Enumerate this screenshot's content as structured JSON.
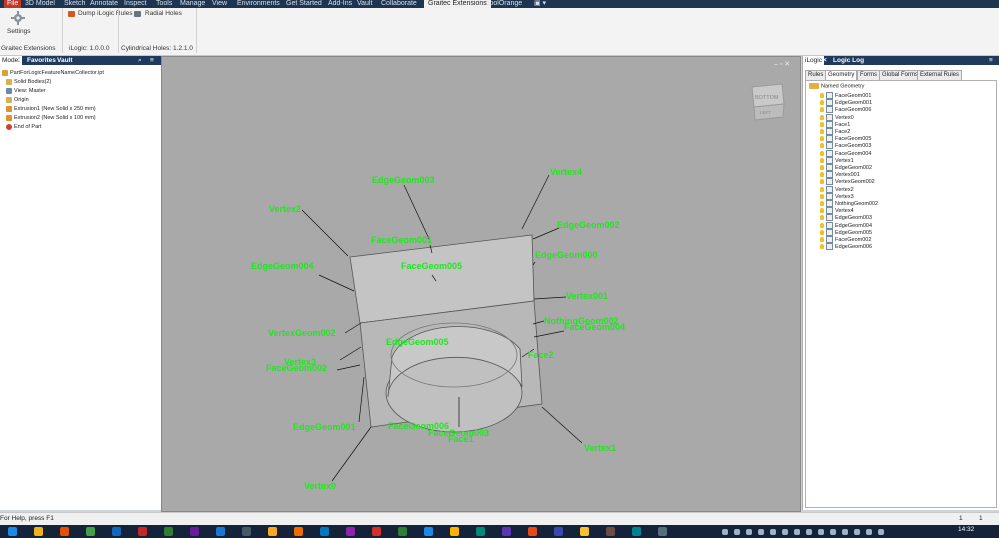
{
  "menubar": {
    "items": [
      "File",
      "3D Model",
      "Sketch",
      "Annotate",
      "Inspect",
      "Tools",
      "Manage",
      "View",
      "Environments",
      "Get Started",
      "Add-Ins",
      "Vault",
      "Collaborate",
      "Graitec Extensions",
      "coolOrange"
    ],
    "active_index": 13
  },
  "ribbon": {
    "settings_label": "Settings",
    "dump_label": "Dump iLogic Rules",
    "radial_label": "Radial Holes",
    "panel_graitec": "Graitec Extensions",
    "panel_ilogic": "iLogic: 1.0.0.0",
    "panel_holes": "Cylindrical Holes: 1.2.1.0"
  },
  "left_panel": {
    "tabs": [
      "Model",
      "Favorites",
      "Vault"
    ],
    "tree": [
      {
        "label": "PartForLogicFeatureNameCollector.ipt",
        "icon": "part-icon"
      },
      {
        "label": "Solid Bodies(2)",
        "icon": "folder-icon"
      },
      {
        "label": "View: Master",
        "icon": "view-icon"
      },
      {
        "label": "Origin",
        "icon": "folder-icon"
      },
      {
        "label": "Extrusion1 (New Solid x 250 mm)",
        "icon": "extrude-icon"
      },
      {
        "label": "Extrusion2 (New Solid x 100 mm)",
        "icon": "extrude-icon"
      },
      {
        "label": "End of Part",
        "icon": "end-icon"
      }
    ]
  },
  "viewport": {
    "viewcube_face": "BOTTOM",
    "viewcube_side": "LEFT",
    "labels": [
      {
        "text": "EdgeGeom003"
      },
      {
        "text": "Vertex4"
      },
      {
        "text": "Vertex2"
      },
      {
        "text": "EdgeGeom002"
      },
      {
        "text": "FaceGeom001"
      },
      {
        "text": "EdgeGeom004"
      },
      {
        "text": "FaceGeom005"
      },
      {
        "text": "EdgeGeom000"
      },
      {
        "text": "Vertex001"
      },
      {
        "text": "NothingGeom002"
      },
      {
        "text": "FaceGeom004"
      },
      {
        "text": "VertexGeom002"
      },
      {
        "text": "EdgeGeom005"
      },
      {
        "text": "Vertex3"
      },
      {
        "text": "Face2"
      },
      {
        "text": "FaceGeom002"
      },
      {
        "text": "EdgeGeom001"
      },
      {
        "text": "FaceGeom006"
      },
      {
        "text": "FaceGeom003"
      },
      {
        "text": "Face1"
      },
      {
        "text": "Vertex1"
      },
      {
        "text": "Vertex0"
      }
    ]
  },
  "right_panel": {
    "tabs": [
      "iLogic",
      "Logic Log"
    ],
    "subtabs": [
      "Rules",
      "Geometry",
      "Forms",
      "Global Forms",
      "External Rules"
    ],
    "root": "Named Geometry",
    "items": [
      "FaceGeom001",
      "EdgeGeom001",
      "FaceGeom006",
      "Vertex0",
      "Face1",
      "Face2",
      "FaceGeom005",
      "FaceGeom003",
      "FaceGeom004",
      "Vertex1",
      "EdgeGeom002",
      "Vertex001",
      "VertexGeom002",
      "Vertex2",
      "Vertex3",
      "NothingGeom002",
      "Vertex4",
      "EdgeGeom003",
      "EdgeGeom004",
      "EdgeGeom005",
      "FaceGeom002",
      "EdgeGeom006"
    ]
  },
  "status": {
    "help_text": "For Help, press F1",
    "count1": "1",
    "count2": "1"
  },
  "taskbar": {
    "time": "14:32"
  }
}
